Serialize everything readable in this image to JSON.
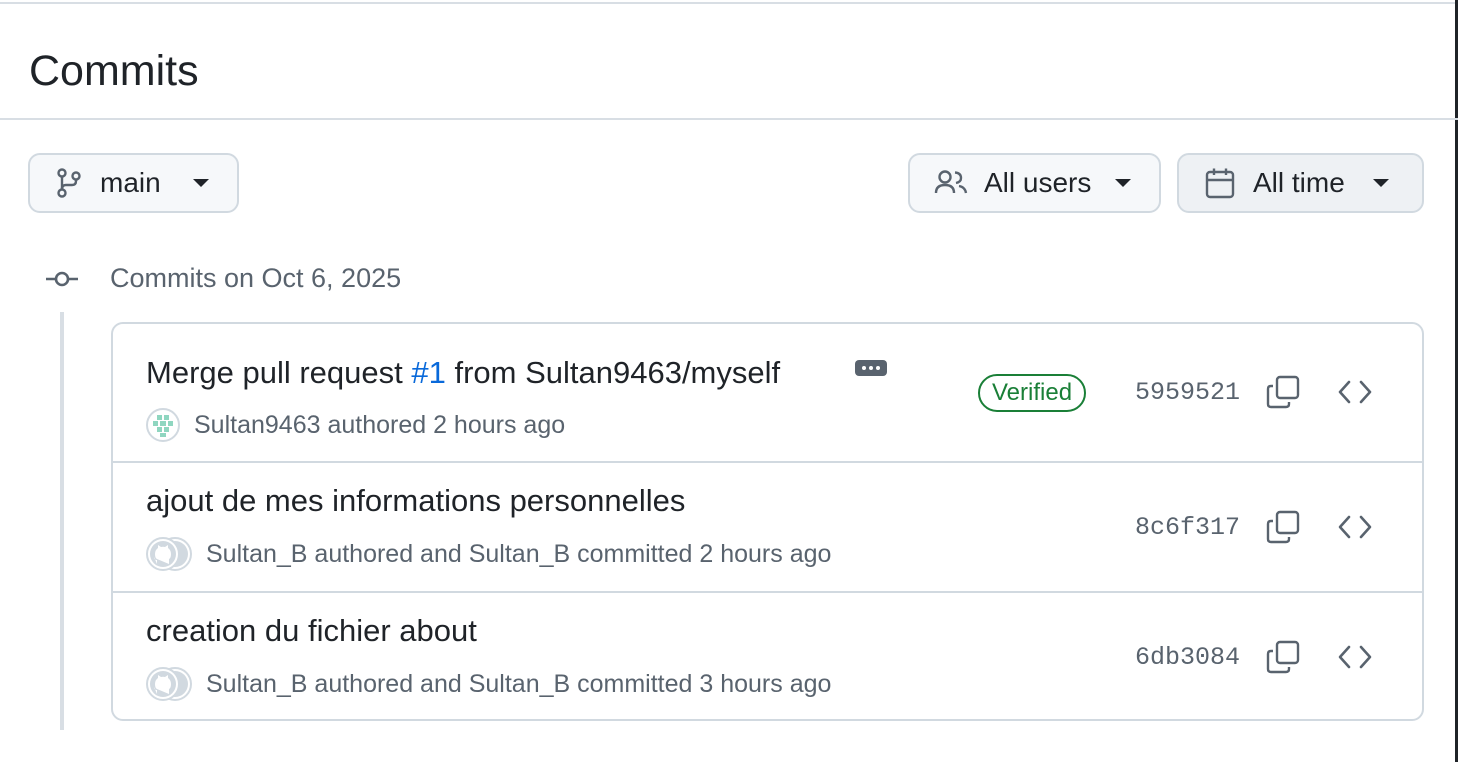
{
  "page": {
    "title": "Commits"
  },
  "filters": {
    "branch": {
      "label": "main",
      "icon": "git-branch-icon"
    },
    "users": {
      "label": "All users",
      "icon": "people-icon"
    },
    "time": {
      "label": "All time",
      "icon": "calendar-icon"
    }
  },
  "group": {
    "title": "Commits on Oct 6, 2025",
    "icon": "git-commit-icon"
  },
  "commits": [
    {
      "message_prefix": "Merge pull request ",
      "pr_link": "#1",
      "message_suffix": " from Sultan9463/myself",
      "meta": "Sultan9463 authored 2 hours ago",
      "badge": "Verified",
      "sha": "5959521"
    },
    {
      "message": "ajout de mes informations personnelles",
      "meta": "Sultan_B authored and Sultan_B committed 2 hours ago",
      "sha": "8c6f317"
    },
    {
      "message": "creation du fichier about",
      "meta": "Sultan_B authored and Sultan_B committed 3 hours ago",
      "sha": "6db3084"
    }
  ],
  "colors": {
    "accent": "#0969da",
    "verified": "#1a7f37",
    "muted": "#59636e",
    "border": "#d1d9e0"
  }
}
